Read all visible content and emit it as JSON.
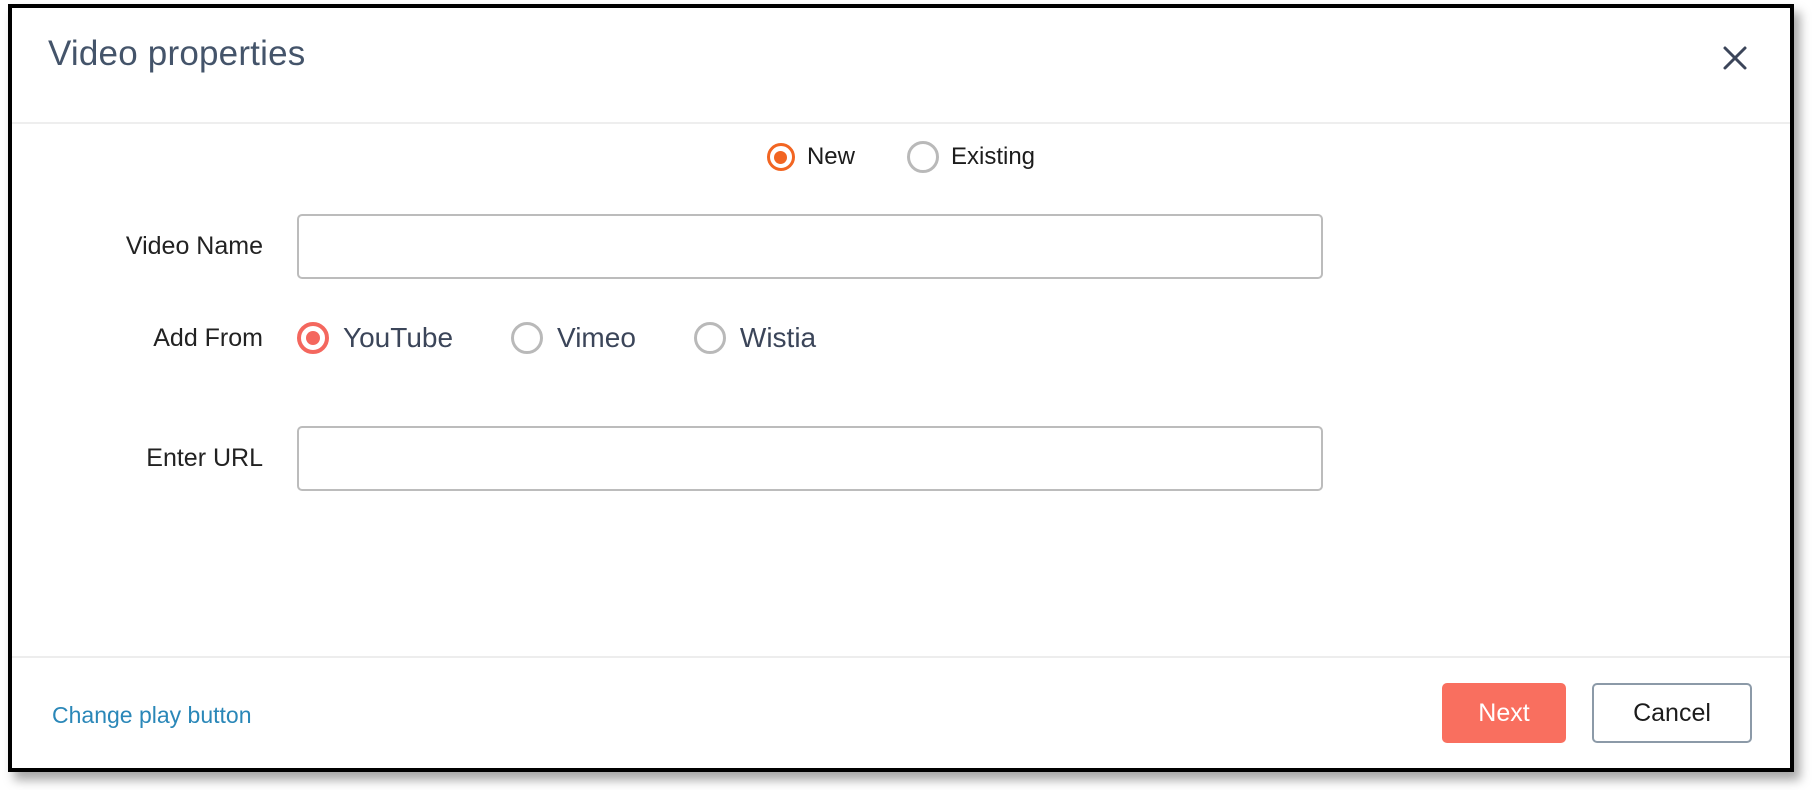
{
  "dialog": {
    "title": "Video properties",
    "close_icon": "close-icon"
  },
  "mode": {
    "options": [
      {
        "label": "New",
        "selected": true,
        "accent": "#f26522"
      },
      {
        "label": "Existing",
        "selected": false
      }
    ]
  },
  "form": {
    "video_name": {
      "label": "Video Name",
      "value": "",
      "placeholder": ""
    },
    "add_from": {
      "label": "Add From",
      "options": [
        {
          "label": "YouTube",
          "selected": true,
          "accent": "#f4675e"
        },
        {
          "label": "Vimeo",
          "selected": false
        },
        {
          "label": "Wistia",
          "selected": false
        }
      ]
    },
    "enter_url": {
      "label": "Enter URL",
      "value": "",
      "placeholder": ""
    },
    "change_play_button_link": "Change play button"
  },
  "footer": {
    "next_label": "Next",
    "cancel_label": "Cancel"
  },
  "colors": {
    "title": "#44546a",
    "link": "#2a87b8",
    "primary_button": "#f96f5f",
    "radio_orange": "#f26522",
    "radio_coral": "#f4675e",
    "input_border": "#bcbcbc",
    "cancel_border": "#8c9aa8"
  }
}
